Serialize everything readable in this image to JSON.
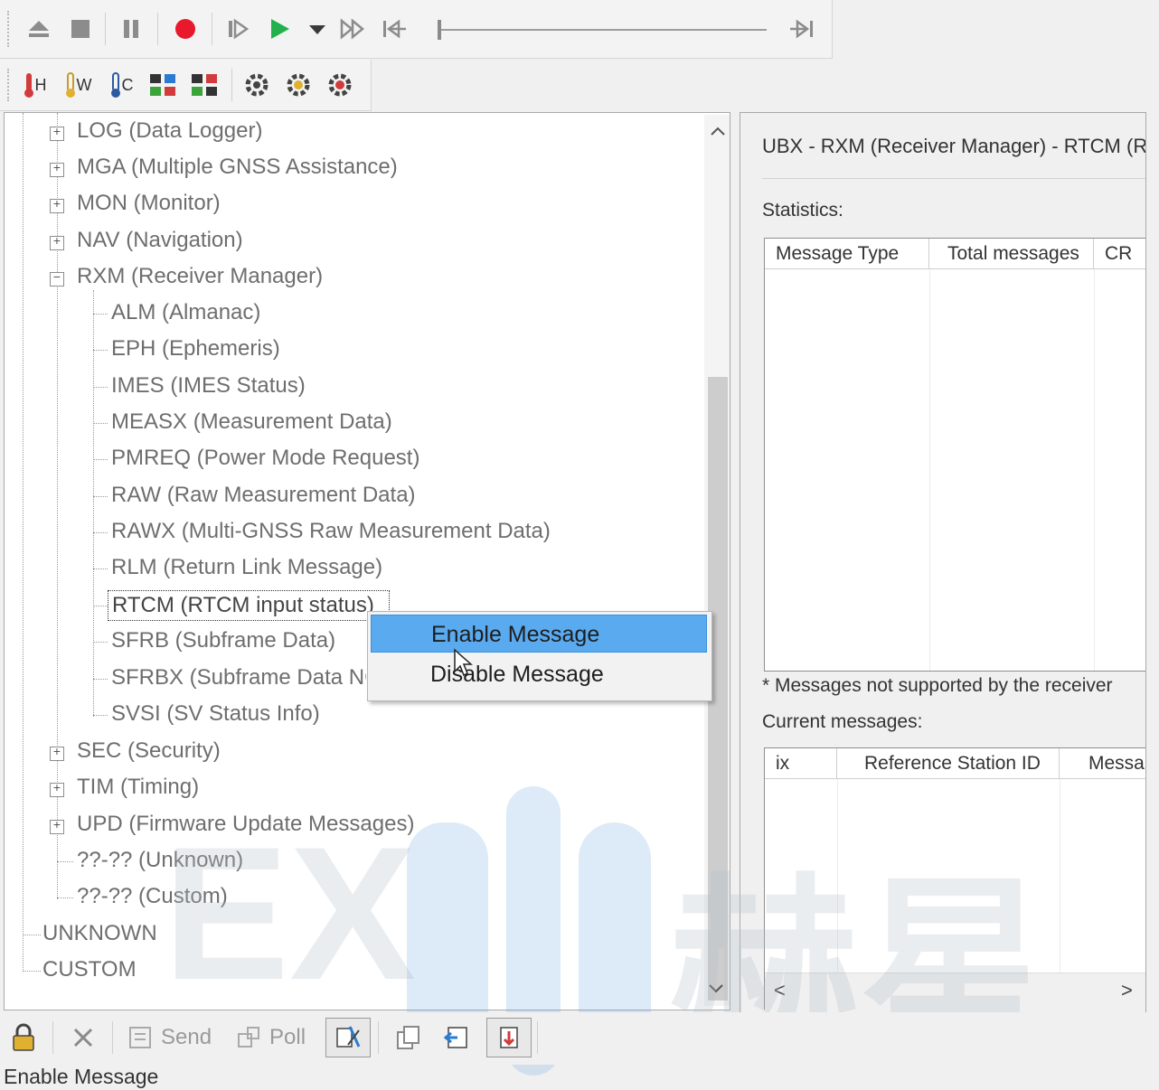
{
  "player_toolbar": {
    "icons": [
      "eject-icon",
      "stop-icon",
      "pause-icon",
      "record-icon",
      "step-forward-icon",
      "play-icon",
      "dropdown-icon",
      "fast-forward-icon",
      "skip-to-start-icon",
      "skip-to-end-icon"
    ],
    "record_color": "#e8192c",
    "play_color": "#22b14c"
  },
  "view_toolbar": {
    "icons": [
      "hot-start-icon",
      "warm-start-icon",
      "cold-start-icon",
      "gnss-config-icon",
      "gnss-config-2-icon",
      "settings-gear-icon",
      "settings-gear-2-icon",
      "settings-gear-red-icon"
    ],
    "labels": [
      "H",
      "W",
      "C"
    ]
  },
  "tree": {
    "top_nodes": [
      {
        "label": "LOG (Data Logger)",
        "expander": "+"
      },
      {
        "label": "MGA (Multiple GNSS Assistance)",
        "expander": "+"
      },
      {
        "label": "MON (Monitor)",
        "expander": "+"
      },
      {
        "label": "NAV (Navigation)",
        "expander": "+"
      },
      {
        "label": "RXM (Receiver Manager)",
        "expander": "−"
      }
    ],
    "rxm_children": [
      "ALM (Almanac)",
      "EPH (Ephemeris)",
      "IMES (IMES Status)",
      "MEASX (Measurement Data)",
      "PMREQ (Power Mode Request)",
      "RAW (Raw Measurement Data)",
      "RAWX (Multi-GNSS Raw Measurement Data)",
      "RLM (Return Link Message)",
      "RTCM (RTCM input status)",
      "SFRB (Subframe Data)",
      "SFRBX (Subframe Data NG)",
      "SVSI (SV Status Info)"
    ],
    "after_nodes": [
      {
        "label": "SEC (Security)",
        "expander": "+"
      },
      {
        "label": "TIM (Timing)",
        "expander": "+"
      },
      {
        "label": "UPD (Firmware Update Messages)",
        "expander": "+"
      },
      {
        "label": "??-?? (Unknown)",
        "expander": ""
      },
      {
        "label": "??-?? (Custom)",
        "expander": ""
      }
    ],
    "root_nodes": [
      "UNKNOWN",
      "CUSTOM"
    ]
  },
  "context_menu": {
    "items": [
      "Enable Message",
      "Disable Message"
    ],
    "highlight_color": "#5aaaf0"
  },
  "right_panel": {
    "title": "UBX - RXM (Receiver Manager) - RTCM (R",
    "statistics_label": "Statistics:",
    "stats_columns": [
      "Message Type",
      "Total messages",
      "CR"
    ],
    "note": "* Messages not supported by the receiver",
    "current_label": "Current messages:",
    "current_columns": [
      "ix",
      "Reference Station ID",
      "Messa"
    ],
    "scroll_left": "<",
    "scroll_right": ">"
  },
  "bottom_toolbar": {
    "send_label": "Send",
    "poll_label": "Poll",
    "icons": [
      "lock-icon",
      "delete-icon",
      "send-icon",
      "poll-icon",
      "auto-poll-icon",
      "copy-icon",
      "load-icon",
      "save-icon"
    ]
  },
  "status_bar": {
    "text": "Enable Message"
  },
  "watermark": {
    "text": "EX",
    "cjk": "赫星"
  }
}
